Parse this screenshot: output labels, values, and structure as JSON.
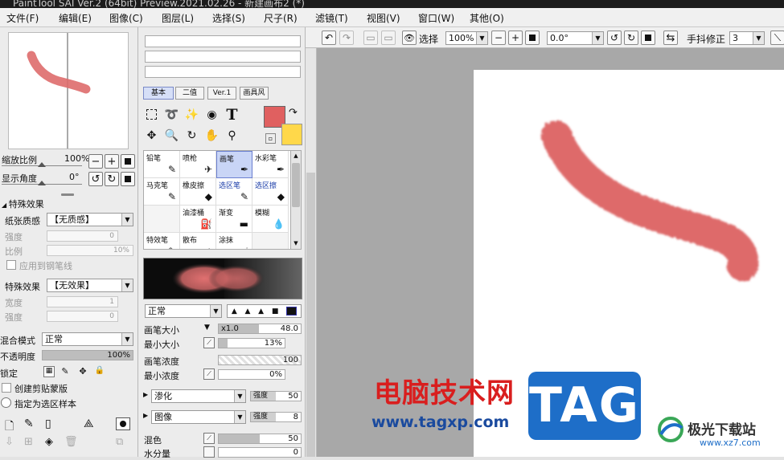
{
  "title": "PaintTool SAI Ver.2 (64bit) Preview.2021.02.26 - 新建画布2 (*)",
  "menu": [
    "文件(F)",
    "编辑(E)",
    "图像(C)",
    "图层(L)",
    "选择(S)",
    "尺子(R)",
    "滤镜(T)",
    "视图(V)",
    "窗口(W)",
    "其他(O)"
  ],
  "nav": {
    "zoom_label": "缩放比例",
    "zoom_value": "100%",
    "angle_label": "显示角度",
    "angle_value": "0°"
  },
  "effects": {
    "header": "特殊效果",
    "paper_label": "纸张质感",
    "paper_value": "【无质感】",
    "strength_label": "强度",
    "strength_value": "0",
    "scale_label": "比例",
    "scale_value": "10%",
    "apply_pen": "应用到钢笔线",
    "effect_label": "特殊效果",
    "effect_value": "【无效果】",
    "width_label": "宽度",
    "width_value": "1",
    "strength2_label": "强度",
    "strength2_value": "0"
  },
  "layer": {
    "blend_label": "混合模式",
    "blend_value": "正常",
    "opacity_label": "不透明度",
    "opacity_value": "100%",
    "opacity_level": 1.0,
    "lock_label": "锁定",
    "clip_label": "创建剪贴蒙版",
    "sample_label": "指定为选区样本"
  },
  "tool_tabs": [
    "基本",
    "二值",
    "Ver.1",
    "画具风"
  ],
  "active_tab": "基本",
  "colors": {
    "main": "#e06060",
    "sub": "#ffd84a",
    "stroke": "#de6b6b",
    "accent": "#c9d5f6"
  },
  "brushes": [
    {
      "name": "铅笔",
      "icon": "pencil-icon",
      "glyph": "✎"
    },
    {
      "name": "喷枪",
      "icon": "airbrush-icon",
      "glyph": "✈"
    },
    {
      "name": "画笔",
      "icon": "brush-icon",
      "glyph": "✒"
    },
    {
      "name": "水彩笔",
      "icon": "watercolor-icon",
      "glyph": "✒"
    },
    {
      "name": "马克笔",
      "icon": "marker-icon",
      "glyph": "✎"
    },
    {
      "name": "橡皮擦",
      "icon": "eraser-icon",
      "glyph": "◆"
    },
    {
      "name": "选区笔",
      "icon": "selection-pen-icon",
      "glyph": "✎"
    },
    {
      "name": "选区擦",
      "icon": "selection-eraser-icon",
      "glyph": "◆"
    },
    {
      "name": "",
      "icon": "empty-icon",
      "glyph": ""
    },
    {
      "name": "油漆桶",
      "icon": "bucket-icon",
      "glyph": "⛽"
    },
    {
      "name": "渐变",
      "icon": "gradient-icon",
      "glyph": "▬"
    },
    {
      "name": "模糊",
      "icon": "blur-icon",
      "glyph": "💧"
    },
    {
      "name": "特效笔",
      "icon": "fx-pen-icon",
      "glyph": "✎"
    },
    {
      "name": "散布",
      "icon": "scatter-icon",
      "glyph": "∴"
    },
    {
      "name": "涂抹",
      "icon": "smudge-icon",
      "glyph": "☝"
    },
    {
      "name": "",
      "icon": "empty-icon",
      "glyph": ""
    }
  ],
  "selected_brush": "画笔",
  "brush_props": {
    "mode": "正常",
    "size_label": "画笔大小",
    "size_mult": "x1.0",
    "size_value": "48.0",
    "min_size_label": "最小大小",
    "min_size_value": "13%",
    "density_label": "画笔浓度",
    "density_value": "100",
    "min_density_label": "最小浓度",
    "min_density_value": "0%",
    "blend_label": "渗化",
    "blend_strength_label": "强度",
    "blend_strength": "50",
    "texture_label": "图像",
    "texture_strength_label": "强度",
    "texture_strength": "8",
    "mix_label": "混色",
    "mix_value": "50",
    "water_label": "水分量",
    "water_value": "0"
  },
  "canvas_toolbar": {
    "select_label": "选择",
    "zoom": "100%",
    "angle": "0.0°",
    "stabilizer_label": "手抖修正",
    "stabilizer_value": "3"
  },
  "watermark": {
    "site_cn": "电脑技术网",
    "url": "www.tagxp.com",
    "tag": "TAG",
    "logo_cn": "极光下载站",
    "logo_url": "www.xz7.com"
  }
}
